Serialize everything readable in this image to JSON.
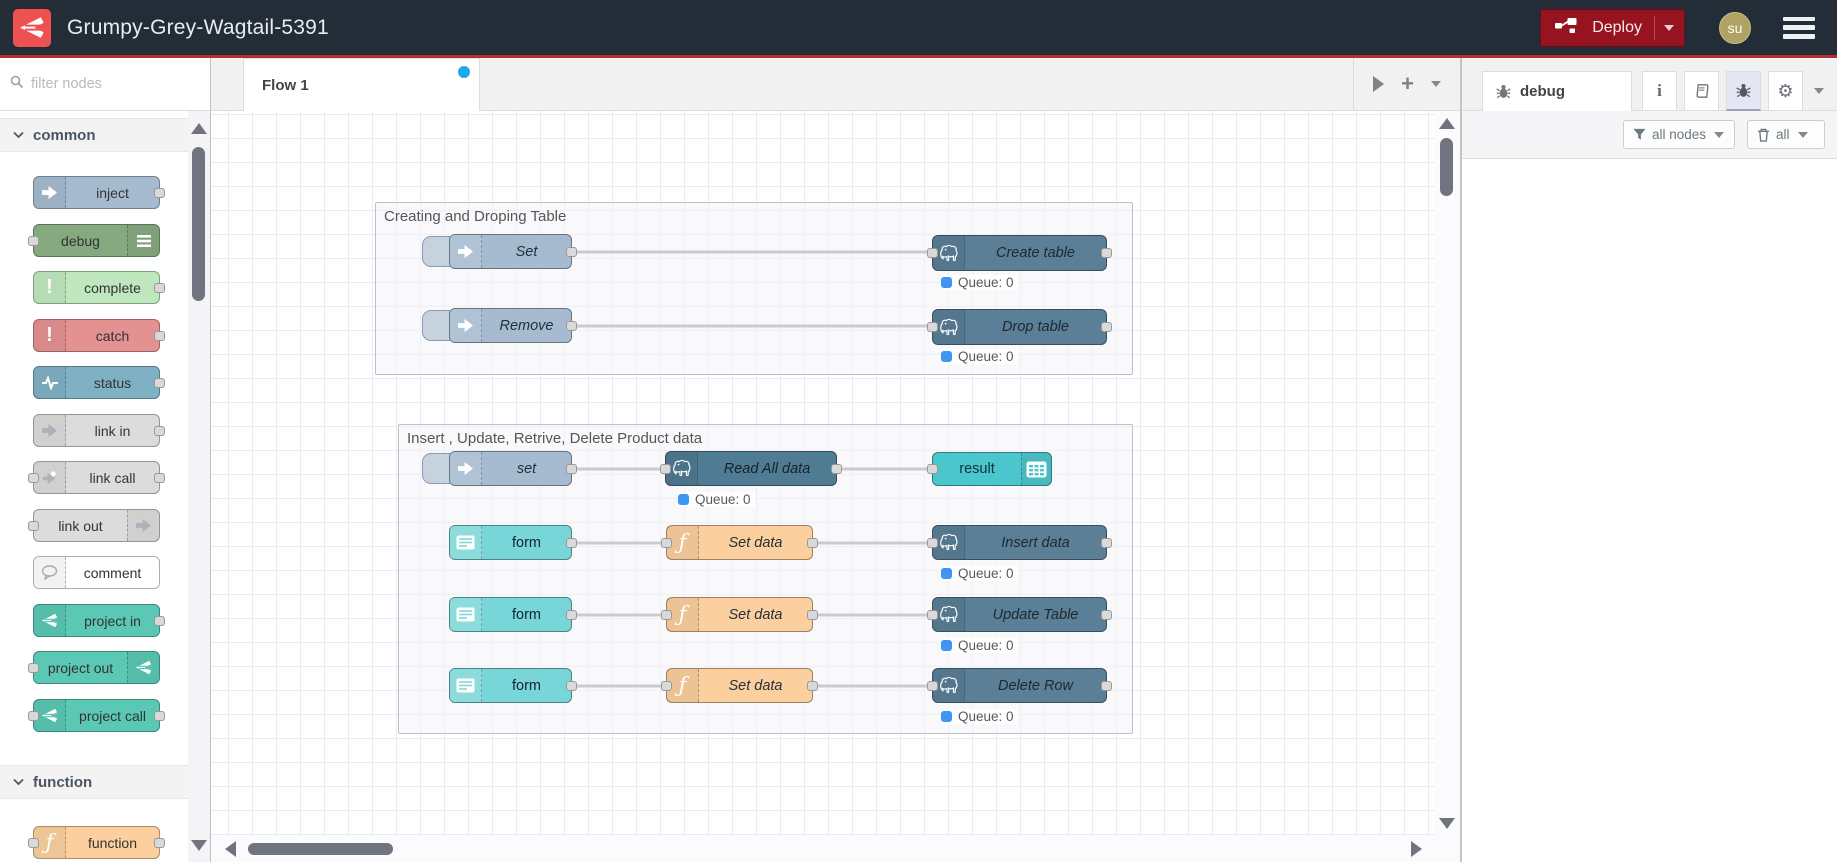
{
  "header": {
    "title": "Grumpy-Grey-Wagtail-5391",
    "deploy_label": "Deploy",
    "avatar_initials": "su"
  },
  "palette": {
    "search_placeholder": "filter nodes",
    "sections": [
      {
        "label": "common",
        "items": [
          "inject",
          "debug",
          "complete",
          "catch",
          "status",
          "link in",
          "link call",
          "link out",
          "comment",
          "project in",
          "project out",
          "project call"
        ]
      },
      {
        "label": "function",
        "items": [
          "function"
        ]
      }
    ]
  },
  "workspace": {
    "active_tab": "Flow 1"
  },
  "flow": {
    "groups": [
      {
        "title": "Creating and Droping Table",
        "rows": [
          {
            "source": "Set",
            "target": "Create table",
            "status": "Queue: 0"
          },
          {
            "source": "Remove",
            "target": "Drop table",
            "status": "Queue: 0"
          }
        ]
      },
      {
        "title": "Insert , Update, Retrive, Delete Product data",
        "pipeline": {
          "source": "set",
          "db": "Read All data",
          "db_status": "Queue: 0",
          "output": "result"
        },
        "rows": [
          {
            "source": "form",
            "fn": "Set data",
            "target": "Insert data",
            "status": "Queue: 0"
          },
          {
            "source": "form",
            "fn": "Set data",
            "target": "Update Table",
            "status": "Queue: 0"
          },
          {
            "source": "form",
            "fn": "Set data",
            "target": "Delete Row",
            "status": "Queue: 0"
          }
        ]
      }
    ]
  },
  "sidebar": {
    "tab_label": "debug",
    "filter_label": "all nodes",
    "clear_label": "all"
  },
  "colors": {
    "header_bg": "#232d38",
    "accent_red": "#bb2b30",
    "deploy_red": "#96141f",
    "tab_dot_blue": "#1fa8e8",
    "status_dot_blue": "#3e96f2",
    "inject_node": "#a6bbcf",
    "debug_node": "#87a980",
    "complete_node": "#bfe8bf",
    "catch_node": "#e49191",
    "status_node": "#7fb1c4",
    "link_node": "#dcdcdc",
    "project_node": "#5ac8b4",
    "function_node": "#fbd09e",
    "form_node": "#79d6d8",
    "postgres_node": "#5b7f96",
    "postgres_node_dark": "#4f7b93",
    "result_node": "#4cc6cd"
  }
}
